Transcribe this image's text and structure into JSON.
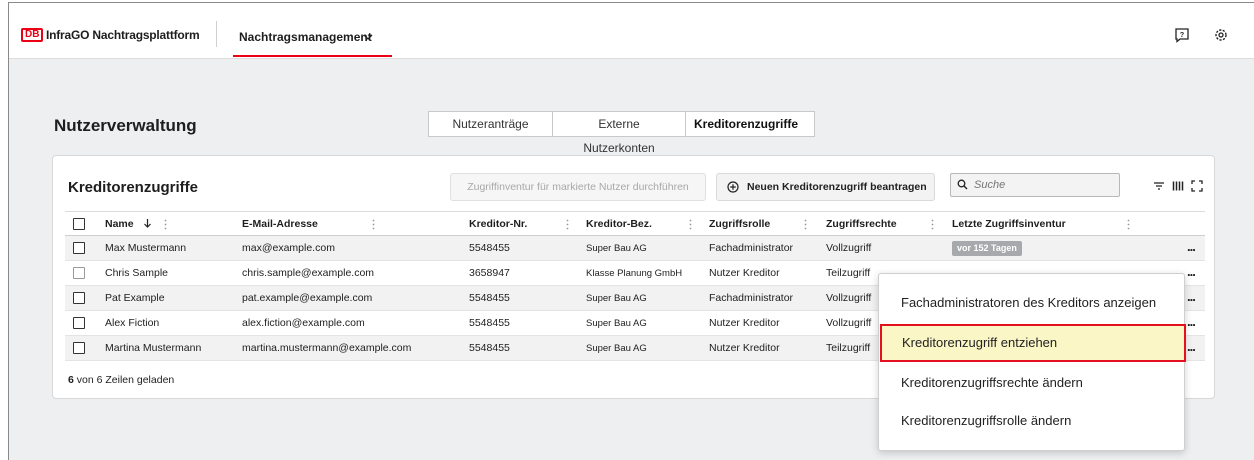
{
  "topbar": {
    "logo": "DB",
    "app_title": "InfraGO Nachtragsplattform",
    "nav_tab": "Nachtragsmanagement"
  },
  "page": {
    "title": "Nutzerverwaltung",
    "tabs": [
      "Nutzeranträge",
      "Externe Nutzerkonten",
      "Kreditorenzugriffe"
    ],
    "active_tab": "Kreditorenzugriffe"
  },
  "card": {
    "title": "Kreditorenzugriffe",
    "btn_inventur": "Zugriffinventur für markierte Nutzer durchführen",
    "btn_new": "Neuen Kreditorenzugriff beantragen",
    "search_placeholder": "Suche"
  },
  "table": {
    "columns": [
      "Name",
      "E-Mail-Adresse",
      "Kreditor-Nr.",
      "Kreditor-Bez.",
      "Zugriffsrolle",
      "Zugriffsrechte",
      "Letzte Zugriffsinventur"
    ],
    "rows": [
      {
        "name": "Max Mustermann",
        "email": "max@example.com",
        "nr": "5548455",
        "bez": "Super Bau AG",
        "rolle": "Fachadministrator",
        "rechte": "Vollzugriff",
        "inventur": "vor 152 Tagen"
      },
      {
        "name": "Chris Sample",
        "email": "chris.sample@example.com",
        "nr": "3658947",
        "bez": "Klasse Planung GmbH",
        "rolle": "Nutzer Kreditor",
        "rechte": "Teilzugriff",
        "inventur": ""
      },
      {
        "name": "Pat Example",
        "email": "pat.example@example.com",
        "nr": "5548455",
        "bez": "Super Bau AG",
        "rolle": "Fachadministrator",
        "rechte": "Vollzugriff",
        "inventur": ""
      },
      {
        "name": "Alex Fiction",
        "email": "alex.fiction@example.com",
        "nr": "5548455",
        "bez": "Super Bau AG",
        "rolle": "Nutzer Kreditor",
        "rechte": "Vollzugriff",
        "inventur": ""
      },
      {
        "name": "Martina Mustermann",
        "email": "martina.mustermann@example.com",
        "nr": "5548455",
        "bez": "Super Bau AG",
        "rolle": "Nutzer Kreditor",
        "rechte": "Teilzugriff",
        "inventur": ""
      }
    ],
    "more_label": "...",
    "loaded_count": "6",
    "loaded_text": " von 6 Zeilen geladen"
  },
  "menu": {
    "items": [
      "Fachadministratoren des Kreditors anzeigen",
      "Kreditorenzugriff entziehen",
      "Kreditorenzugriffsrechte ändern",
      "Kreditorenzugriffsrolle ändern"
    ],
    "highlighted_index": 1
  },
  "colors": {
    "brand_red": "#ec0016",
    "highlight_bg": "#faf6c6",
    "badge_grey": "#a7a9ac"
  }
}
